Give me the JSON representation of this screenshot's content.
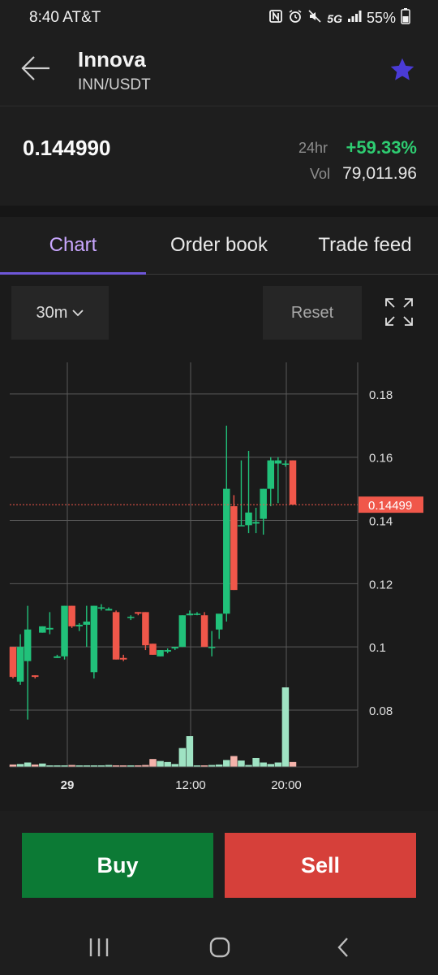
{
  "status": {
    "time": "8:40 AT&T",
    "network": "5G",
    "battery": "55%",
    "icons": [
      "nfc-icon",
      "alarm-icon",
      "mute-icon",
      "signal-icon",
      "battery-icon"
    ]
  },
  "header": {
    "title": "Innova",
    "pair": "INN/USDT",
    "favorite": true
  },
  "price_panel": {
    "price": "0.144990",
    "change_label": "24hr",
    "change": "+59.33%",
    "volume_label": "Vol",
    "volume": "79,011.96"
  },
  "tabs": [
    {
      "label": "Chart",
      "active": true
    },
    {
      "label": "Order book",
      "active": false
    },
    {
      "label": "Trade feed",
      "active": false
    }
  ],
  "chart_controls": {
    "timeframe": "30m",
    "reset_label": "Reset"
  },
  "colors": {
    "up": "#21c17a",
    "down": "#f0574a",
    "volume_up": "#9fe3c3",
    "volume_down": "#f5b3ab",
    "accent": "#6e57d8",
    "current_price_tag": "#f0574a"
  },
  "chart_data": {
    "type": "candlestick",
    "interval": "30m",
    "ylim": [
      0.062,
      0.19
    ],
    "yticks": [
      0.08,
      0.1,
      0.12,
      0.14,
      0.16,
      0.18
    ],
    "ytick_labels": [
      "0.08",
      "0.1",
      "0.12",
      "0.14",
      "0.16",
      "0.18"
    ],
    "xtick_labels": [
      "29",
      "12:00",
      "20:00"
    ],
    "current_price": 0.14499,
    "current_price_label": "0.14499",
    "candles": [
      {
        "o": 0.1,
        "h": 0.1,
        "l": 0.09,
        "c": 0.0905
      },
      {
        "o": 0.089,
        "h": 0.104,
        "l": 0.088,
        "c": 0.1
      },
      {
        "o": 0.0955,
        "h": 0.113,
        "l": 0.077,
        "c": 0.1055
      },
      {
        "o": 0.091,
        "h": 0.091,
        "l": 0.09,
        "c": 0.0905
      },
      {
        "o": 0.1045,
        "h": 0.1065,
        "l": 0.1045,
        "c": 0.1065
      },
      {
        "o": 0.1055,
        "h": 0.111,
        "l": 0.104,
        "c": 0.106
      },
      {
        "o": 0.0965,
        "h": 0.0975,
        "l": 0.0965,
        "c": 0.097
      },
      {
        "o": 0.097,
        "h": 0.113,
        "l": 0.096,
        "c": 0.113
      },
      {
        "o": 0.113,
        "h": 0.113,
        "l": 0.106,
        "c": 0.1065
      },
      {
        "o": 0.1065,
        "h": 0.1075,
        "l": 0.105,
        "c": 0.107
      },
      {
        "o": 0.107,
        "h": 0.113,
        "l": 0.1,
        "c": 0.108
      },
      {
        "o": 0.092,
        "h": 0.113,
        "l": 0.09,
        "c": 0.113
      },
      {
        "o": 0.1125,
        "h": 0.1135,
        "l": 0.1115,
        "c": 0.1125
      },
      {
        "o": 0.1115,
        "h": 0.1125,
        "l": 0.1115,
        "c": 0.112
      },
      {
        "o": 0.111,
        "h": 0.1115,
        "l": 0.096,
        "c": 0.096
      },
      {
        "o": 0.0965,
        "h": 0.0975,
        "l": 0.0955,
        "c": 0.096
      },
      {
        "o": 0.1095,
        "h": 0.11,
        "l": 0.1085,
        "c": 0.1095
      },
      {
        "o": 0.111,
        "h": 0.111,
        "l": 0.11,
        "c": 0.1105
      },
      {
        "o": 0.111,
        "h": 0.111,
        "l": 0.099,
        "c": 0.1005
      },
      {
        "o": 0.101,
        "h": 0.101,
        "l": 0.0975,
        "c": 0.0975
      },
      {
        "o": 0.097,
        "h": 0.099,
        "l": 0.097,
        "c": 0.099
      },
      {
        "o": 0.0985,
        "h": 0.0995,
        "l": 0.098,
        "c": 0.099
      },
      {
        "o": 0.0995,
        "h": 0.1,
        "l": 0.099,
        "c": 0.1
      },
      {
        "o": 0.1,
        "h": 0.11,
        "l": 0.1,
        "c": 0.11
      },
      {
        "o": 0.11,
        "h": 0.1115,
        "l": 0.11,
        "c": 0.1105
      },
      {
        "o": 0.1105,
        "h": 0.111,
        "l": 0.11,
        "c": 0.1105
      },
      {
        "o": 0.11,
        "h": 0.111,
        "l": 0.1,
        "c": 0.1
      },
      {
        "o": 0.1,
        "h": 0.105,
        "l": 0.097,
        "c": 0.1
      },
      {
        "o": 0.1055,
        "h": 0.1065,
        "l": 0.1025,
        "c": 0.1105
      },
      {
        "o": 0.1105,
        "h": 0.17,
        "l": 0.108,
        "c": 0.15
      },
      {
        "o": 0.1445,
        "h": 0.148,
        "l": 0.118,
        "c": 0.118
      },
      {
        "o": 0.1385,
        "h": 0.159,
        "l": 0.1385,
        "c": 0.1385
      },
      {
        "o": 0.1385,
        "h": 0.162,
        "l": 0.136,
        "c": 0.1425
      },
      {
        "o": 0.139,
        "h": 0.144,
        "l": 0.136,
        "c": 0.1395
      },
      {
        "o": 0.1405,
        "h": 0.15,
        "l": 0.1355,
        "c": 0.15
      },
      {
        "o": 0.15,
        "h": 0.16,
        "l": 0.1445,
        "c": 0.159
      },
      {
        "o": 0.158,
        "h": 0.16,
        "l": 0.1455,
        "c": 0.159
      },
      {
        "o": 0.158,
        "h": 0.159,
        "l": 0.157,
        "c": 0.158
      },
      {
        "o": 0.159,
        "h": 0.159,
        "l": 0.145,
        "c": 0.145
      }
    ],
    "volumes": [
      0.5,
      0.6,
      0.9,
      0.5,
      0.7,
      0.2,
      0.2,
      0.3,
      0.4,
      0.2,
      0.2,
      0.3,
      0.2,
      0.4,
      0.2,
      0.3,
      0.3,
      0.3,
      0.4,
      1.6,
      1.2,
      1.0,
      0.6,
      3.8,
      6.2,
      0.2,
      0.3,
      0.4,
      0.5,
      1.4,
      2.2,
      1.3,
      0.4,
      1.8,
      0.9,
      0.6,
      0.9,
      16.0,
      1.0
    ]
  },
  "actions": {
    "buy_label": "Buy",
    "sell_label": "Sell"
  },
  "navbar": {
    "icons": [
      "recent-apps-icon",
      "home-icon",
      "back-nav-icon"
    ]
  }
}
